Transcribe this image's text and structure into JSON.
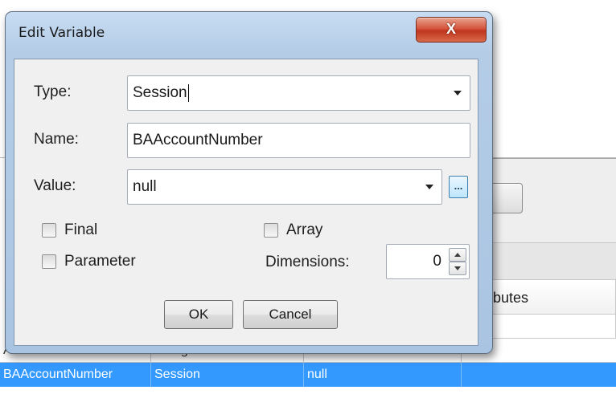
{
  "dialog": {
    "title": "Edit Variable",
    "close_label": "X",
    "type": {
      "label": "Type:",
      "value": "Session"
    },
    "name": {
      "label": "Name:",
      "value": "BAAccountNumber"
    },
    "value": {
      "label": "Value:",
      "value": "null",
      "ellipsis": "..."
    },
    "checkboxes": {
      "final": {
        "label": "Final",
        "checked": false
      },
      "parameter": {
        "label": "Parameter",
        "checked": false
      },
      "array": {
        "label": "Array",
        "checked": false
      }
    },
    "dimensions": {
      "label": "Dimensions:",
      "value": "0"
    },
    "ok_label": "OK",
    "cancel_label": "Cancel"
  },
  "background_table": {
    "header_partial": "ibutes",
    "rows": [
      {
        "name": "AccountNumber",
        "type": "String",
        "value": "",
        "selected": false
      },
      {
        "name": "BAAccountNumber",
        "type": "Session",
        "value": "null",
        "selected": true
      }
    ]
  },
  "colors": {
    "selection": "#3399ff",
    "dialog_frame": "#b4cce6",
    "close_button": "#c0361e"
  }
}
